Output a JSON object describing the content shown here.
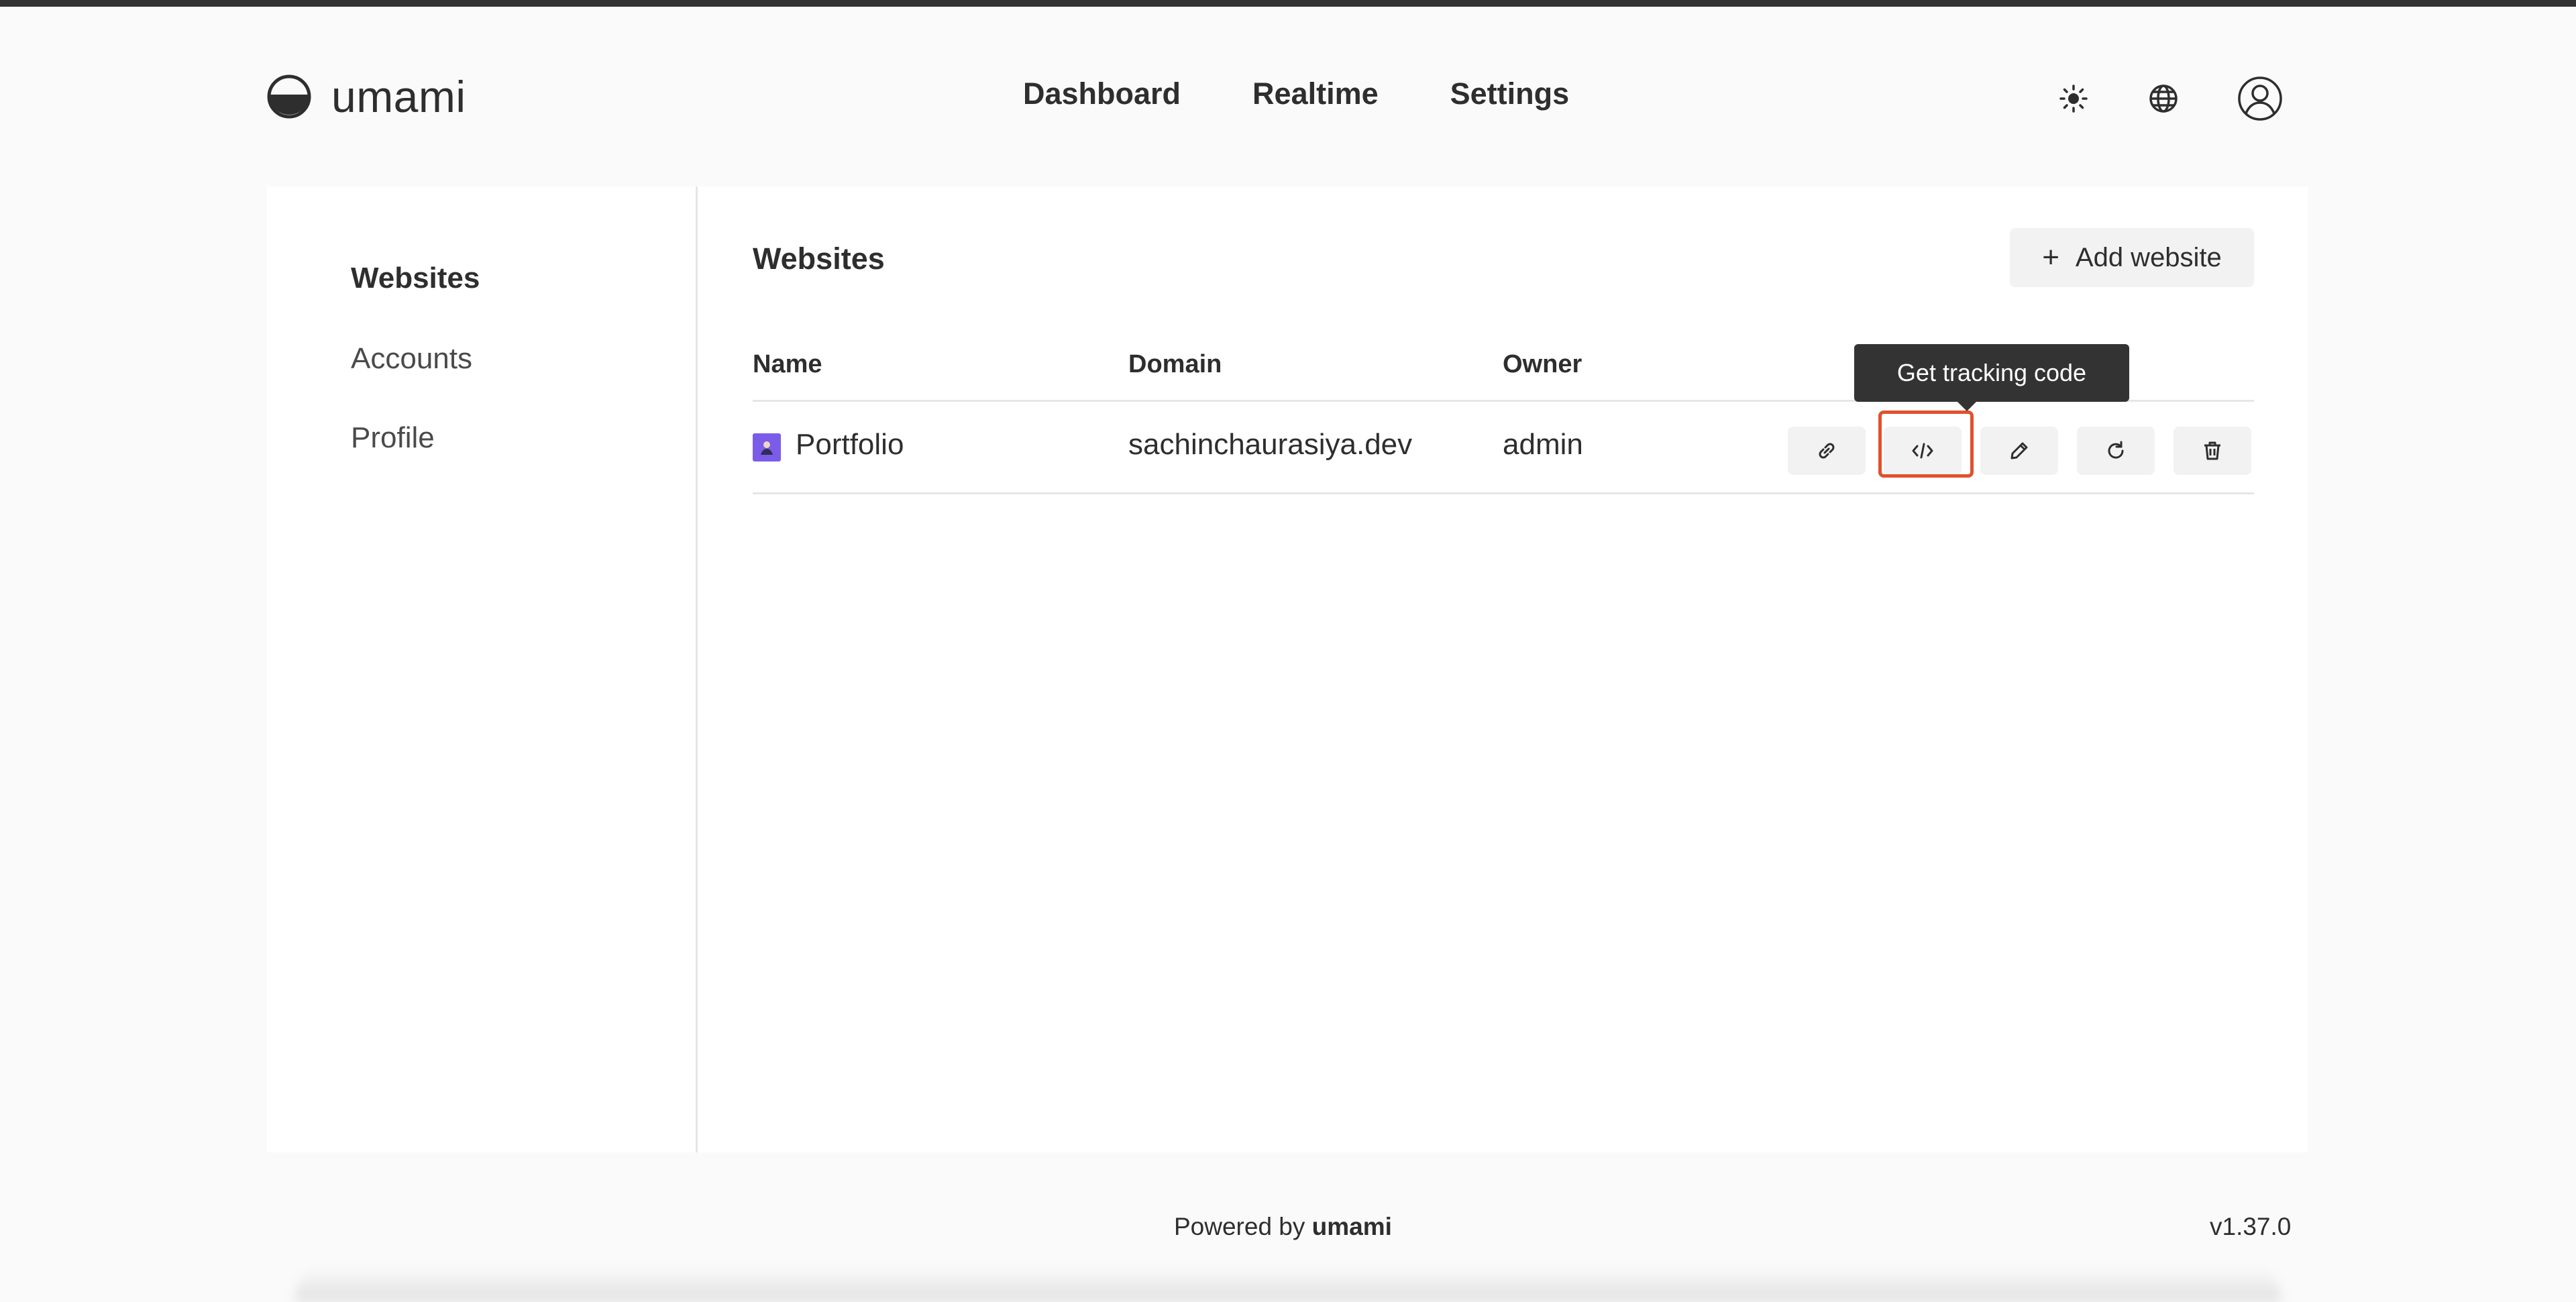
{
  "app": {
    "name": "umami"
  },
  "nav": {
    "items": [
      {
        "label": "Dashboard"
      },
      {
        "label": "Realtime"
      },
      {
        "label": "Settings"
      }
    ]
  },
  "header_icons": [
    "sun-icon",
    "globe-icon",
    "user-icon"
  ],
  "sidebar": {
    "items": [
      {
        "label": "Websites",
        "active": true
      },
      {
        "label": "Accounts",
        "active": false
      },
      {
        "label": "Profile",
        "active": false
      }
    ]
  },
  "content": {
    "title": "Websites",
    "add_button": "Add website",
    "columns": [
      "Name",
      "Domain",
      "Owner"
    ],
    "rows": [
      {
        "name": "Portfolio",
        "domain": "sachinchaurasiya.dev",
        "owner": "admin",
        "actions": [
          "link-icon",
          "code-icon",
          "pencil-icon",
          "refresh-icon",
          "trash-icon"
        ]
      }
    ],
    "tooltip": "Get tracking code"
  },
  "footer": {
    "powered_by": "Powered by",
    "brand": "umami",
    "version": "v1.37.0"
  },
  "colors": {
    "background": "#fafafa",
    "card": "#ffffff",
    "button": "#f2f2f2",
    "tooltip": "#333333",
    "highlight": "#e0512d",
    "favicon": "#7b5ce8"
  }
}
